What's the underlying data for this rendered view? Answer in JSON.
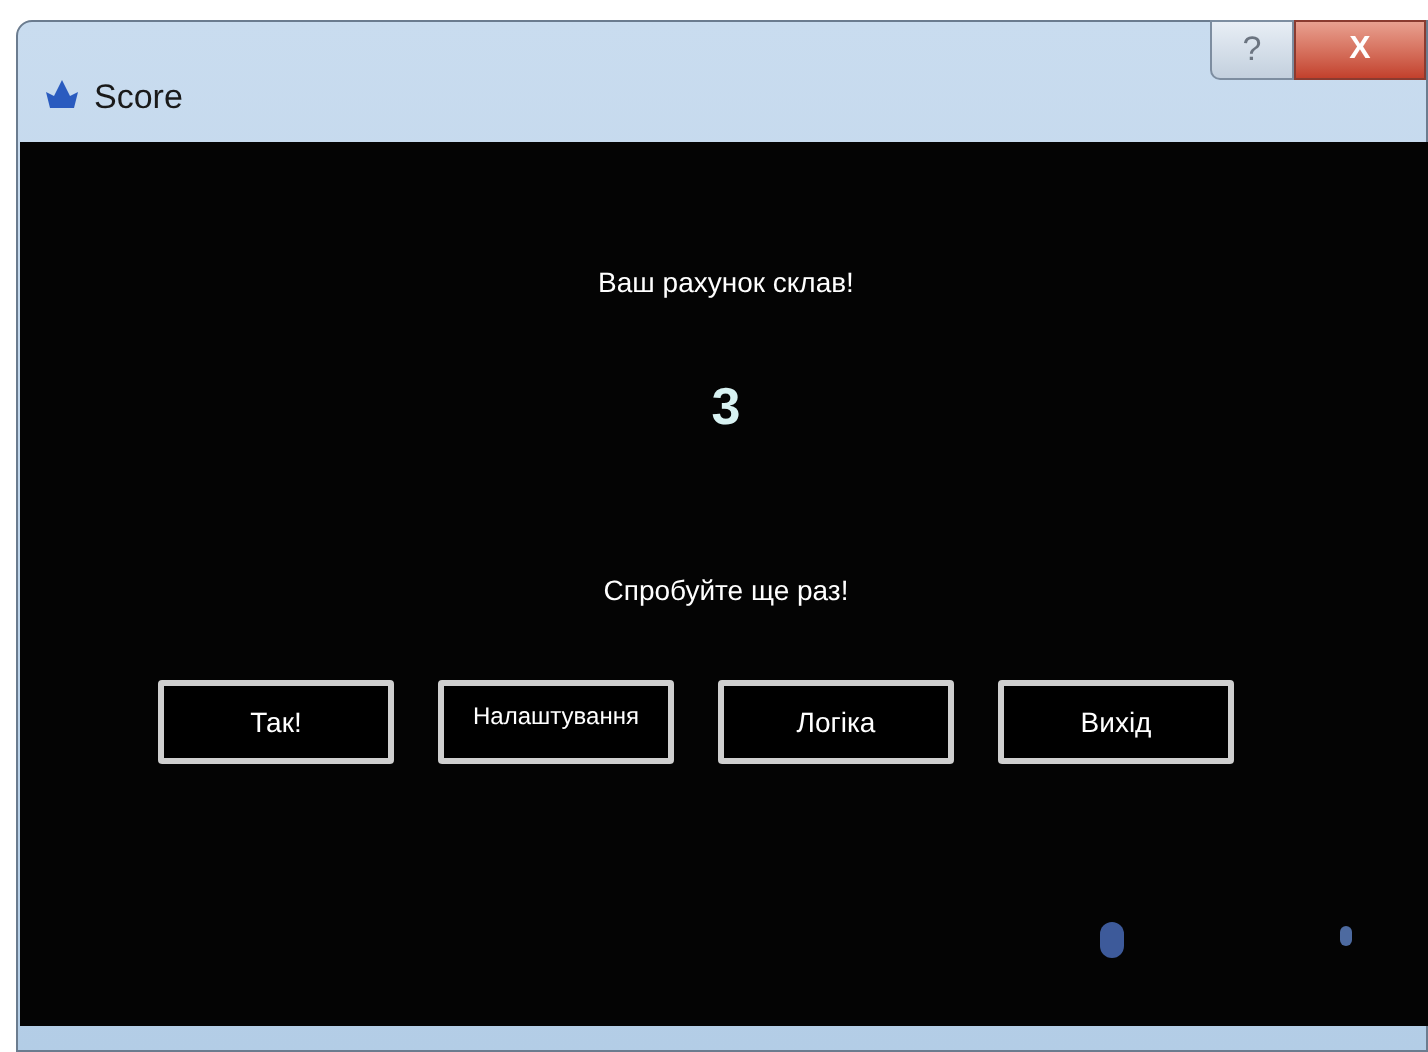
{
  "window": {
    "title": "Score",
    "help_button": "?",
    "close_button": "X"
  },
  "message": "Ваш рахунок склав!",
  "score": "3",
  "prompt": "Спробуйте ще раз!",
  "buttons": [
    {
      "label": "Так!",
      "small": false
    },
    {
      "label": "Налаштування",
      "small": true
    },
    {
      "label": "Логіка",
      "small": false
    },
    {
      "label": "Вихід",
      "small": false
    }
  ]
}
